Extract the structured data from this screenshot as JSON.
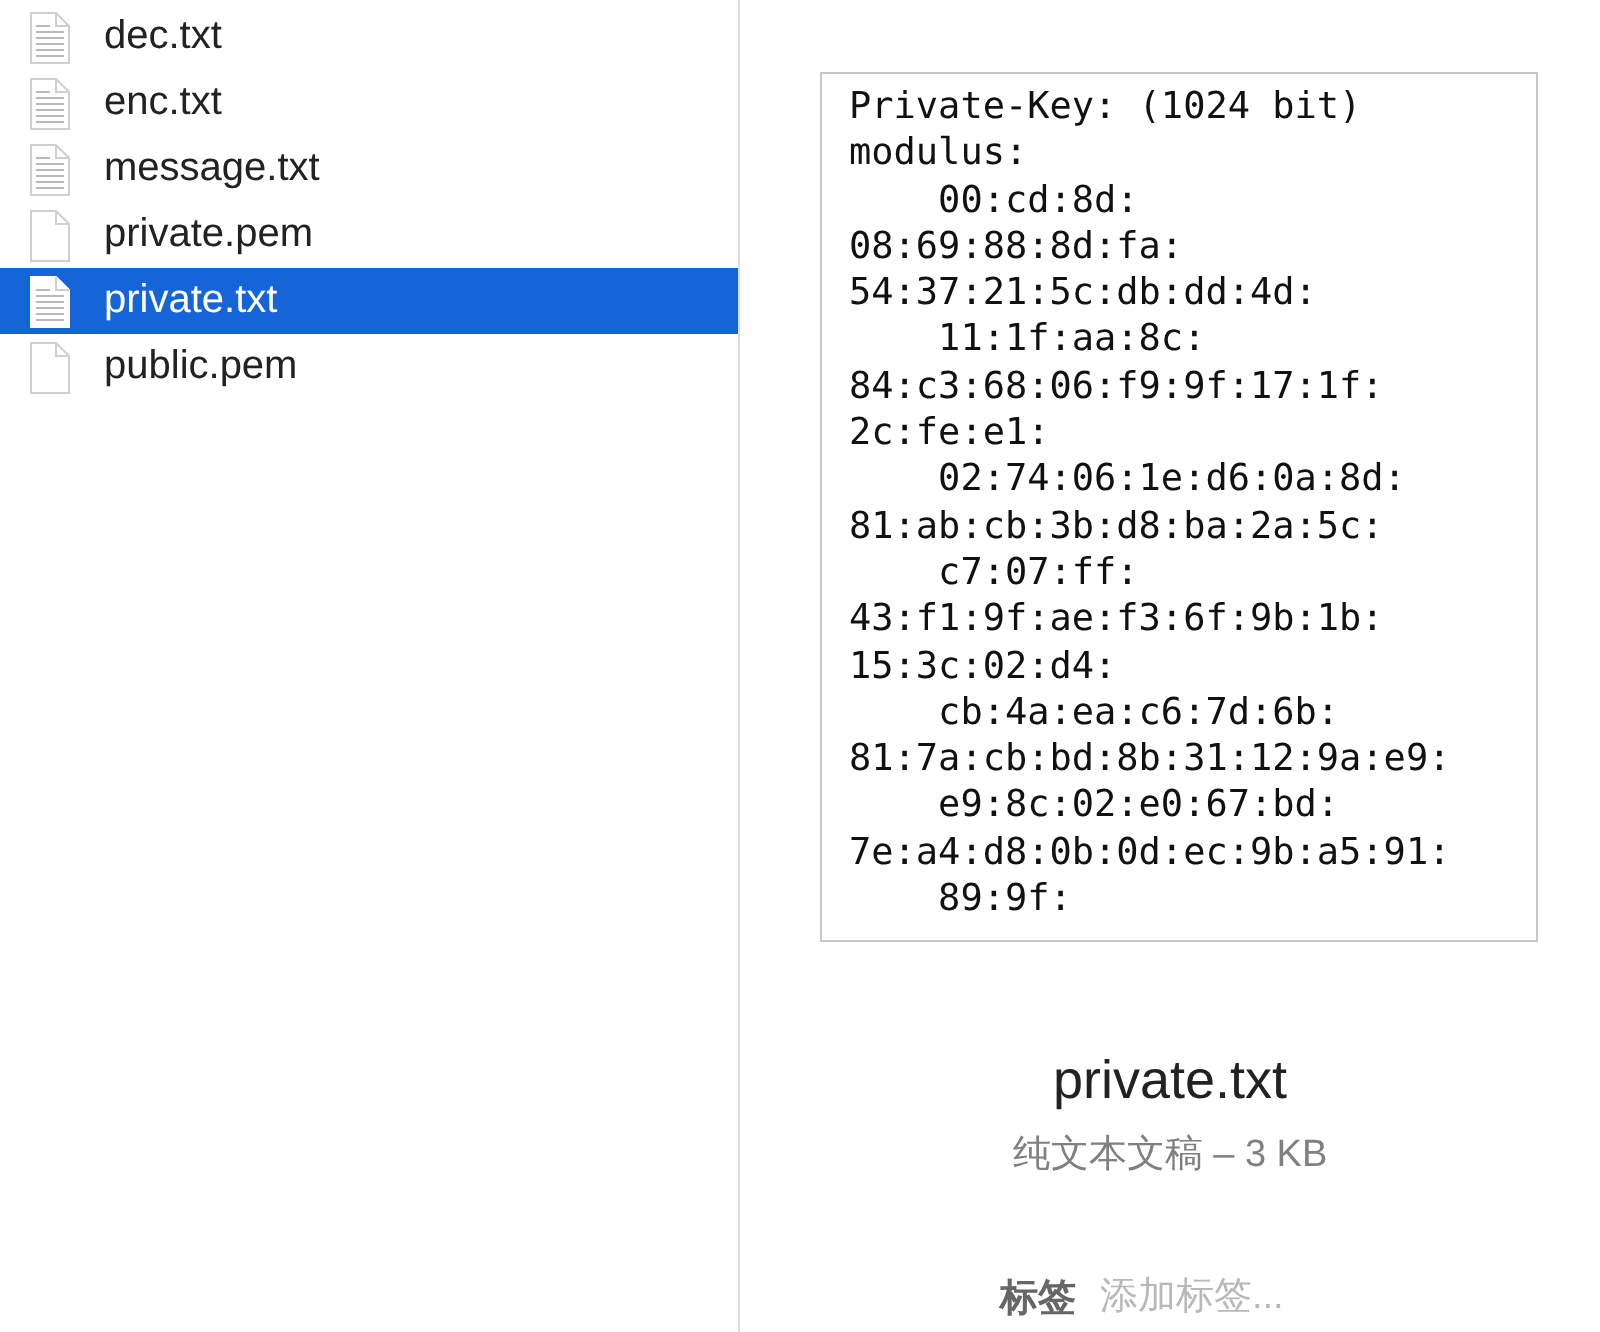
{
  "files": [
    {
      "name": "dec.txt",
      "kind": "text",
      "selected": false
    },
    {
      "name": "enc.txt",
      "kind": "text",
      "selected": false
    },
    {
      "name": "message.txt",
      "kind": "text",
      "selected": false
    },
    {
      "name": "private.pem",
      "kind": "blank",
      "selected": false
    },
    {
      "name": "private.txt",
      "kind": "text",
      "selected": true
    },
    {
      "name": "public.pem",
      "kind": "blank",
      "selected": false
    }
  ],
  "preview": {
    "lines": [
      "Private-Key: (1024 bit)",
      "modulus:",
      "    00:cd:8d:",
      "08:69:88:8d:fa:",
      "54:37:21:5c:db:dd:4d:",
      "    11:1f:aa:8c:",
      "84:c3:68:06:f9:9f:17:1f:",
      "2c:fe:e1:",
      "    02:74:06:1e:d6:0a:8d:",
      "81:ab:cb:3b:d8:ba:2a:5c:",
      "    c7:07:ff:",
      "43:f1:9f:ae:f3:6f:9b:1b:",
      "15:3c:02:d4:",
      "    cb:4a:ea:c6:7d:6b:",
      "81:7a:cb:bd:8b:31:12:9a:e9:",
      "    e9:8c:02:e0:67:bd:",
      "7e:a4:d8:0b:0d:ec:9b:a5:91:",
      "    89:9f:"
    ]
  },
  "file_name": "private.txt",
  "file_info": "纯文本文稿 – 3 KB",
  "tags_label": "标签",
  "tags_placeholder": "添加标签..."
}
